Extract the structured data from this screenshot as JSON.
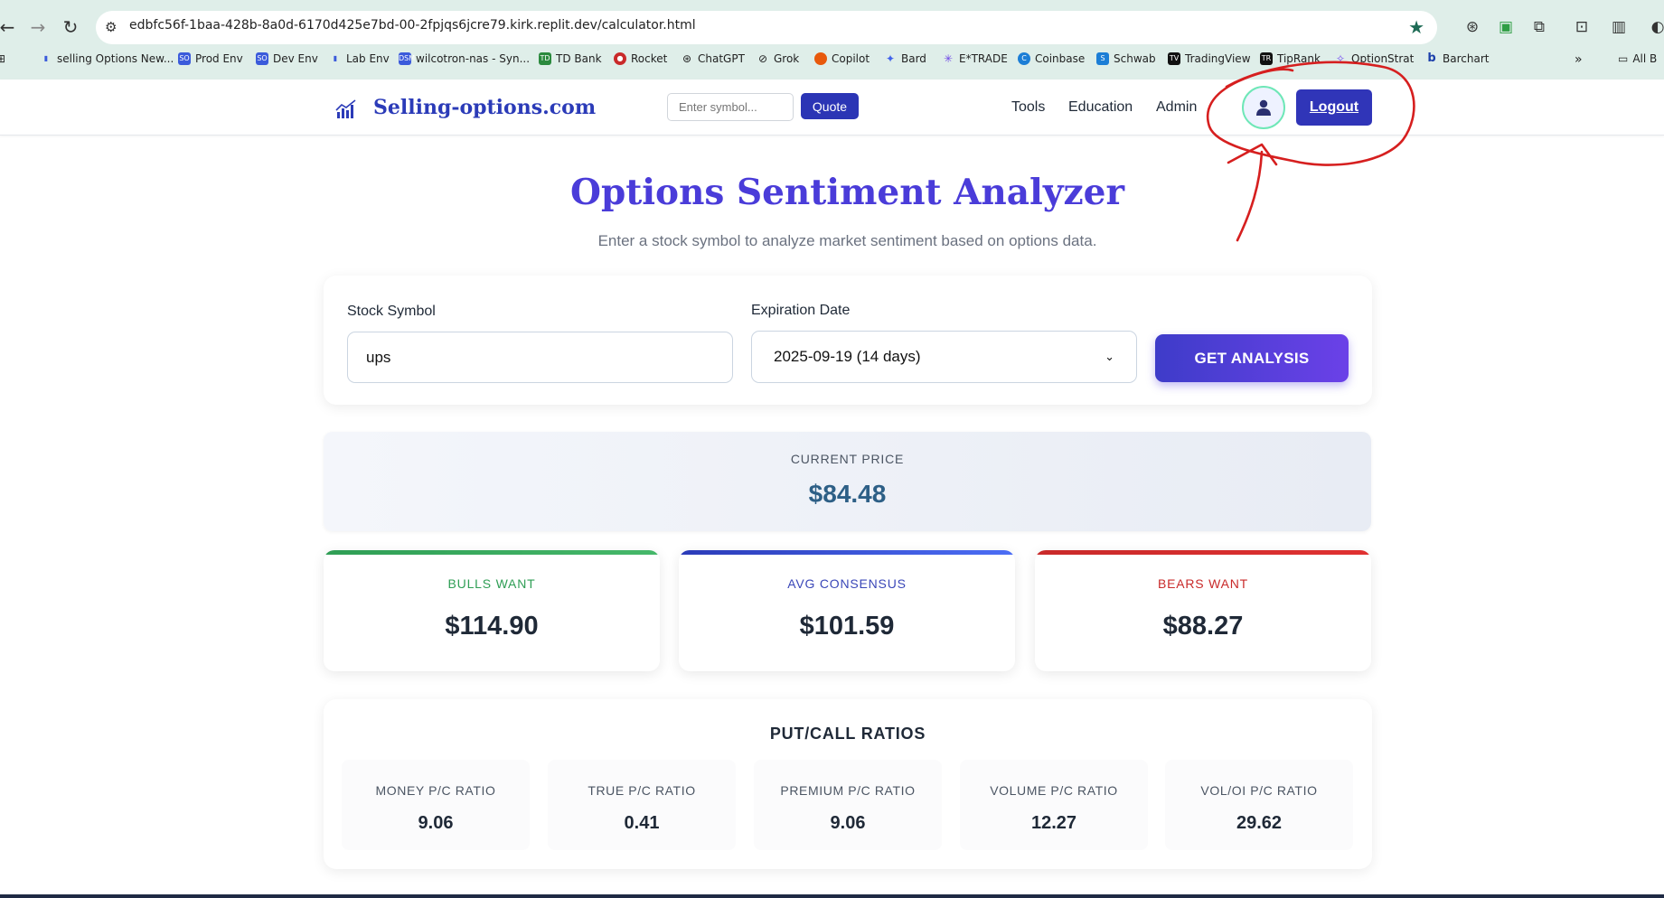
{
  "browser": {
    "url": "edbfc56f-1baa-428b-8a0d-6170d425e7bd-00-2fpjqs6jcre79.kirk.replit.dev/calculator.html",
    "bookmarks": [
      {
        "label": "selling Options New..."
      },
      {
        "label": "Prod Env"
      },
      {
        "label": "Dev Env"
      },
      {
        "label": "Lab Env"
      },
      {
        "label": "wilcotron-nas - Syn..."
      },
      {
        "label": "TD Bank"
      },
      {
        "label": "Rocket"
      },
      {
        "label": "ChatGPT"
      },
      {
        "label": "Grok"
      },
      {
        "label": "Copilot"
      },
      {
        "label": "Bard"
      },
      {
        "label": "E*TRADE"
      },
      {
        "label": "Coinbase"
      },
      {
        "label": "Schwab"
      },
      {
        "label": "TradingView"
      },
      {
        "label": "TipRank"
      },
      {
        "label": "OptionStrat"
      },
      {
        "label": "Barchart"
      }
    ],
    "all_bookmarks": "All B"
  },
  "header": {
    "brand": "Selling-options.com",
    "symbol_placeholder": "Enter symbol...",
    "quote_label": "Quote",
    "nav": [
      "Tools",
      "Education",
      "Admin"
    ],
    "logout_label": "Logout"
  },
  "main": {
    "title": "Options Sentiment Analyzer",
    "subtitle": "Enter a stock symbol to analyze market sentiment based on options data.",
    "form": {
      "stock_label": "Stock Symbol",
      "stock_value": "ups",
      "expiration_label": "Expiration Date",
      "expiration_value": "2025-09-19 (14 days)",
      "button_label": "GET ANALYSIS"
    },
    "current_price": {
      "label": "CURRENT PRICE",
      "value": "$84.48"
    },
    "targets": [
      {
        "label": "BULLS WANT",
        "value": "$114.90",
        "color": "#2f9e55"
      },
      {
        "label": "AVG CONSENSUS",
        "value": "$101.59",
        "color": "#3a47b8"
      },
      {
        "label": "BEARS WANT",
        "value": "$88.27",
        "color": "#c92a2a"
      }
    ],
    "ratios": {
      "title": "PUT/CALL RATIOS",
      "items": [
        {
          "label": "MONEY P/C RATIO",
          "value": "9.06"
        },
        {
          "label": "TRUE P/C RATIO",
          "value": "0.41"
        },
        {
          "label": "PREMIUM P/C RATIO",
          "value": "9.06"
        },
        {
          "label": "VOLUME P/C RATIO",
          "value": "12.27"
        },
        {
          "label": "VOL/OI P/C RATIO",
          "value": "29.62"
        }
      ]
    }
  },
  "colors": {
    "brand": "#2b3bb8",
    "accent": "#4a3cd9",
    "annotation": "#d61f1f"
  }
}
